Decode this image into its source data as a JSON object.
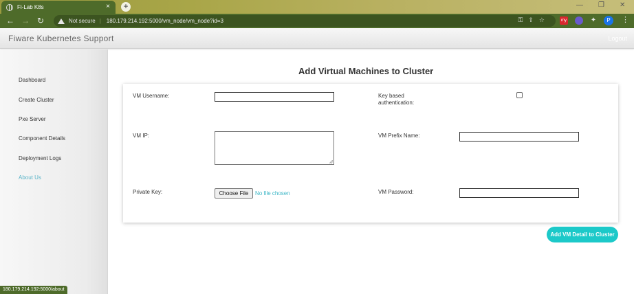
{
  "browser": {
    "tab_title": "Fi-Lab K8s",
    "tab_close": "×",
    "new_tab": "+",
    "security_label": "Not secure",
    "separator": "|",
    "url": "180.179.214.192:5000/vm_node/vm_node?id=3",
    "profile_initial": "P",
    "status_url": "180.179.214.192:5000/about",
    "nav_back": "←",
    "nav_forward": "→",
    "nav_reload": "↻",
    "menu_glyph": "⋮",
    "win_minimize": "—",
    "win_restore": "❐",
    "win_close": "✕",
    "ext_label": "my"
  },
  "app": {
    "brand": "Fiware Kubernetes Support",
    "logout": "Logout"
  },
  "sidebar": {
    "items": [
      {
        "label": "Dashboard"
      },
      {
        "label": "Create Cluster"
      },
      {
        "label": "Pxe Server"
      },
      {
        "label": "Component Details"
      },
      {
        "label": "Deployment Logs"
      },
      {
        "label": "About Us"
      }
    ],
    "active_index": 5
  },
  "form": {
    "title": "Add Virtual Machines to Cluster",
    "vm_username_label": "VM Username:",
    "vm_username_value": "",
    "key_auth_label_line1": "Key based",
    "key_auth_label_line2": "authentication:",
    "key_auth_checked": false,
    "vm_ip_label": "VM IP:",
    "vm_ip_value": "",
    "vm_prefix_label": "VM Prefix Name:",
    "vm_prefix_value": "",
    "private_key_label": "Private Key:",
    "choose_file_label": "Choose File",
    "no_file_text": "No file chosen",
    "vm_password_label": "VM Password:",
    "vm_password_value": "",
    "submit_label": "Add VM Detail to Cluster"
  },
  "colors": {
    "accent": "#1cc9c9",
    "link": "#5ab4c8",
    "chrome": "#4e6b2a"
  }
}
